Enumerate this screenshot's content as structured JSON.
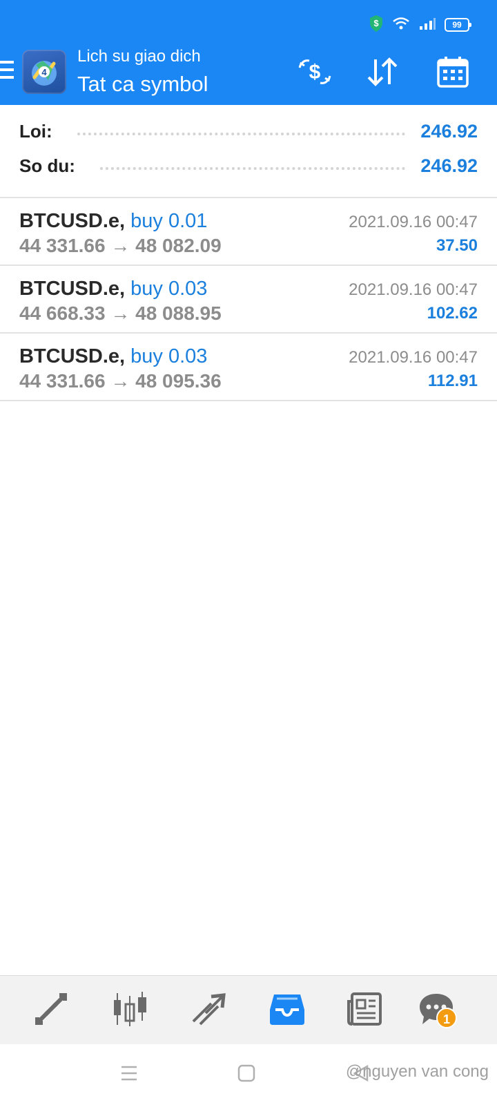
{
  "status_bar": {
    "battery": "99"
  },
  "header": {
    "subtitle": "Lich su giao dich",
    "title": "Tat ca symbol"
  },
  "summary": {
    "profit_label": "Loi:",
    "profit_value": "246.92",
    "balance_label": "So du:",
    "balance_value": "246.92"
  },
  "trades": [
    {
      "symbol": "BTCUSD.e,",
      "side": "buy 0.01",
      "prices": "44 331.66 → 48 082.09",
      "date": "2021.09.16 00:47",
      "profit": "37.50"
    },
    {
      "symbol": "BTCUSD.e,",
      "side": "buy 0.03",
      "prices": "44 668.33 → 48 088.95",
      "date": "2021.09.16 00:47",
      "profit": "102.62"
    },
    {
      "symbol": "BTCUSD.e,",
      "side": "buy 0.03",
      "prices": "44 331.66 → 48 095.36",
      "date": "2021.09.16 00:47",
      "profit": "112.91"
    }
  ],
  "bottom_nav": {
    "items": [
      {
        "icon": "quotes-icon"
      },
      {
        "icon": "chart-icon"
      },
      {
        "icon": "trade-icon"
      },
      {
        "icon": "history-icon",
        "active": true
      },
      {
        "icon": "news-icon"
      },
      {
        "icon": "messages-icon",
        "badge": "1"
      }
    ]
  },
  "watermark": "@nguyen van cong",
  "colors": {
    "accent": "#1a87f5",
    "value_blue": "#1a7fdd",
    "muted": "#8c8c8c",
    "badge": "#f39c12"
  }
}
